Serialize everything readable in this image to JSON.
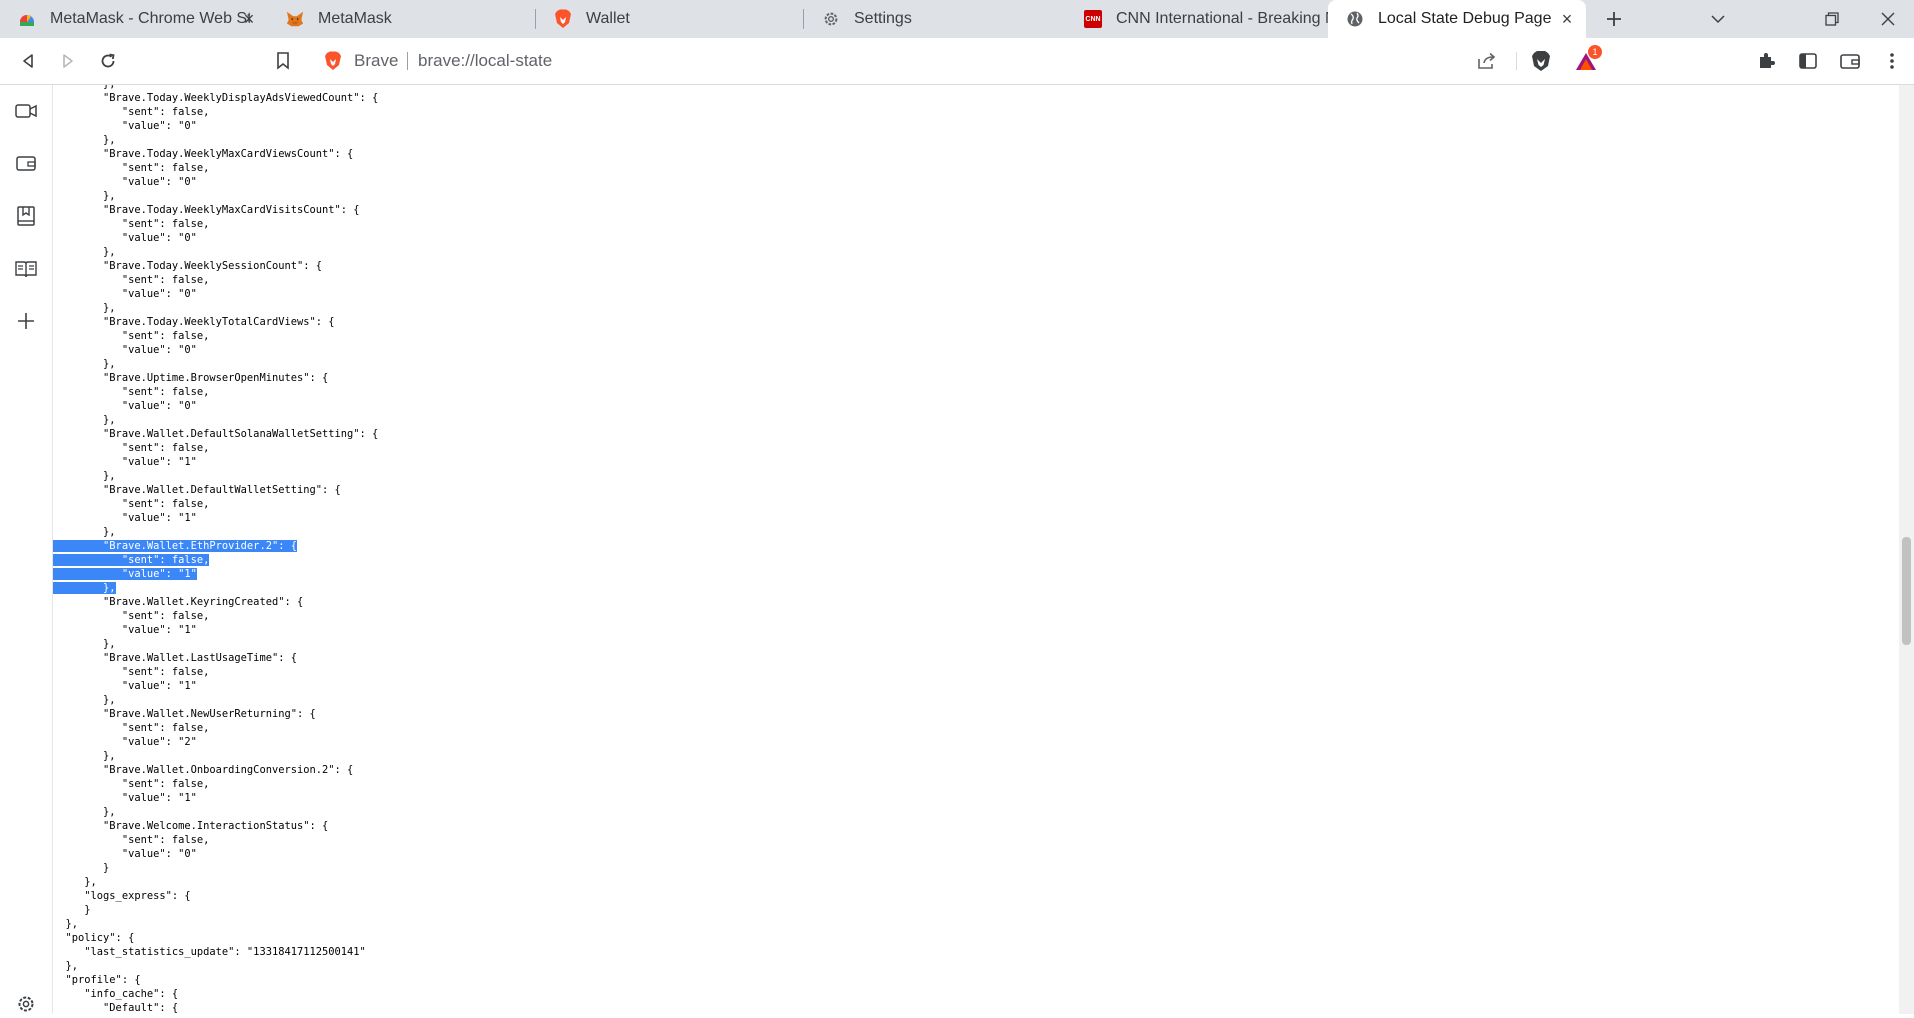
{
  "tabs": [
    {
      "title": "MetaMask - Chrome Web Sto",
      "icon": "chrome-webstore-icon"
    },
    {
      "title": "MetaMask",
      "icon": "metamask-fox-icon"
    },
    {
      "title": "Wallet",
      "icon": "brave-lion-icon"
    },
    {
      "title": "Settings",
      "icon": "gear-icon"
    },
    {
      "title": "CNN International - Breaking Ne",
      "icon": "cnn-logo-icon"
    },
    {
      "title": "Local State Debug Page",
      "icon": "globe-icon",
      "active": true
    }
  ],
  "toolbar": {
    "omnibox_brand": "Brave",
    "url": "brave://local-state",
    "rewards_badge": "1"
  },
  "colors": {
    "tabstrip_bg": "#dee1e6",
    "selection": "#3b87f7",
    "brave_orange": "#fb542b"
  },
  "json_lines": [
    "        },",
    "        \"Brave.Today.WeeklyDisplayAdsViewedCount\": {",
    "           \"sent\": false,",
    "           \"value\": \"0\"",
    "        },",
    "        \"Brave.Today.WeeklyMaxCardViewsCount\": {",
    "           \"sent\": false,",
    "           \"value\": \"0\"",
    "        },",
    "        \"Brave.Today.WeeklyMaxCardVisitsCount\": {",
    "           \"sent\": false,",
    "           \"value\": \"0\"",
    "        },",
    "        \"Brave.Today.WeeklySessionCount\": {",
    "           \"sent\": false,",
    "           \"value\": \"0\"",
    "        },",
    "        \"Brave.Today.WeeklyTotalCardViews\": {",
    "           \"sent\": false,",
    "           \"value\": \"0\"",
    "        },",
    "        \"Brave.Uptime.BrowserOpenMinutes\": {",
    "           \"sent\": false,",
    "           \"value\": \"0\"",
    "        },",
    "        \"Brave.Wallet.DefaultSolanaWalletSetting\": {",
    "           \"sent\": false,",
    "           \"value\": \"1\"",
    "        },",
    "        \"Brave.Wallet.DefaultWalletSetting\": {",
    "           \"sent\": false,",
    "           \"value\": \"1\"",
    "        },",
    "        \"Brave.Wallet.EthProvider.2\": {",
    "           \"sent\": false,",
    "           \"value\": \"1\"",
    "        },",
    "        \"Brave.Wallet.KeyringCreated\": {",
    "           \"sent\": false,",
    "           \"value\": \"1\"",
    "        },",
    "        \"Brave.Wallet.LastUsageTime\": {",
    "           \"sent\": false,",
    "           \"value\": \"1\"",
    "        },",
    "        \"Brave.Wallet.NewUserReturning\": {",
    "           \"sent\": false,",
    "           \"value\": \"2\"",
    "        },",
    "        \"Brave.Wallet.OnboardingConversion.2\": {",
    "           \"sent\": false,",
    "           \"value\": \"1\"",
    "        },",
    "        \"Brave.Welcome.InteractionStatus\": {",
    "           \"sent\": false,",
    "           \"value\": \"0\"",
    "        }",
    "     },",
    "     \"logs_express\": {",
    "     }",
    "  },",
    "  \"policy\": {",
    "     \"last_statistics_update\": \"13318417112500141\"",
    "  },",
    "  \"profile\": {",
    "     \"info_cache\": {",
    "        \"Default\": {"
  ],
  "highlight": {
    "from": 33,
    "to": 36
  }
}
